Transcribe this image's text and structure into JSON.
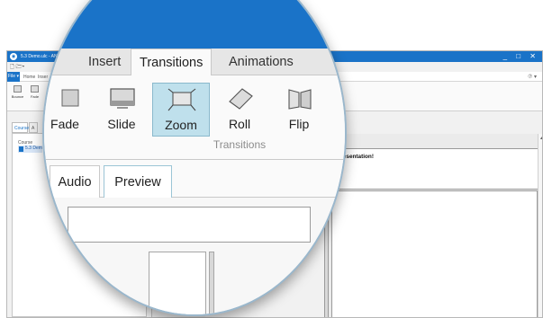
{
  "window": {
    "title": "5.3 Demo.ulc - ANCILE uPerform",
    "controls": "_ □ ✕"
  },
  "quick_access": {
    "label": "🗋 🗁▾"
  },
  "menubar": {
    "file_label": "File ▾",
    "home_label": "Home",
    "insert_label": "Inser",
    "help_label": "⑦ ▾"
  },
  "ribbon_small": {
    "bounce_label": "Bounce",
    "fade_label": "Fade"
  },
  "panel_tabs": {
    "course": "Course",
    "second": "A"
  },
  "left_panel": {
    "heading": "Course",
    "item": "5.3 Dem"
  },
  "slide": {
    "title": ".3 Presentation!"
  },
  "scroll": {
    "up": "▲"
  },
  "magnifier": {
    "tabs": {
      "insert": "Insert",
      "transitions": "Transitions",
      "animations": "Animations"
    },
    "buttons": {
      "fade": "Fade",
      "slide": "Slide",
      "zoom": "Zoom",
      "roll": "Roll",
      "flip": "Flip"
    },
    "group_label": "Transitions",
    "subtabs": {
      "audio": "Audio",
      "preview": "Preview"
    },
    "selected_button": "zoom"
  },
  "colors": {
    "brand_blue": "#1a73c8",
    "selected_button": "#bfe0ec"
  }
}
